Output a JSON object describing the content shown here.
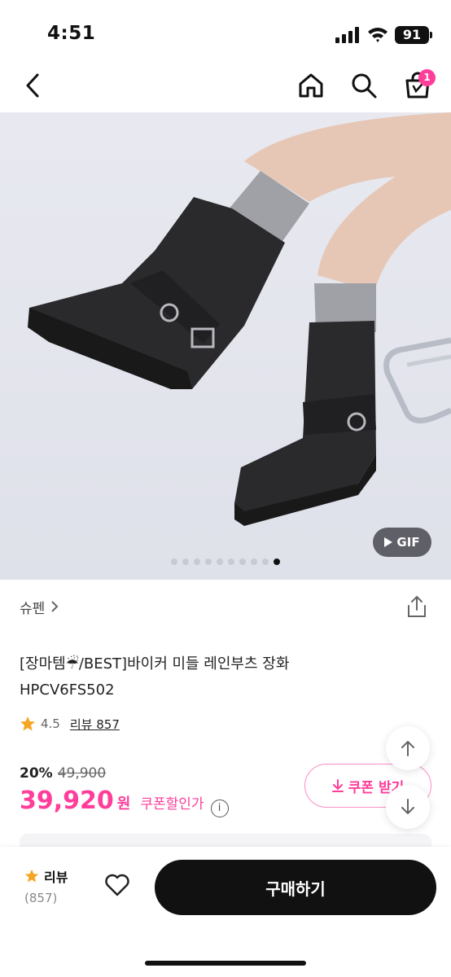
{
  "status_bar": {
    "time": "4:51",
    "battery": "91",
    "icons": [
      "signal-icon",
      "wifi-icon",
      "battery-icon"
    ]
  },
  "nav": {
    "icons": [
      "back-icon",
      "home-icon",
      "search-icon",
      "cart-icon"
    ],
    "cart_badge": "1",
    "accent_color": "#ff3d9a"
  },
  "gallery": {
    "gif_label": "GIF",
    "dot_count": 10,
    "active_dot": 10
  },
  "product": {
    "brand": "슈펜",
    "title_line1": "[장마템☔/BEST]바이커 미들 레인부츠 장화",
    "title_line2": "HPCV6FS502",
    "rating": "4.5",
    "review_label": "리뷰 857",
    "discount_rate": "20%",
    "original_price": "49,900",
    "price": "39,920",
    "currency": "원",
    "coupon_price_label": "쿠폰할인가",
    "coupon_button": "쿠폰 받기"
  },
  "bottom_bar": {
    "review_tab_label": "리뷰",
    "review_tab_count": "(857)",
    "buy_button": "구매하기"
  }
}
